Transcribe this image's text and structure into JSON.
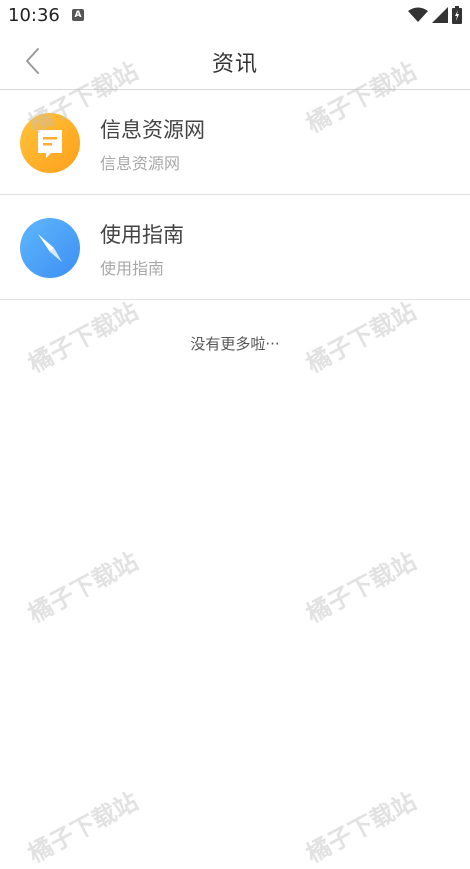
{
  "status_bar": {
    "time": "10:36",
    "notification_icon": "A"
  },
  "header": {
    "title": "资讯"
  },
  "items": [
    {
      "title": "信息资源网",
      "subtitle": "信息资源网",
      "icon": "bookmark-note-icon",
      "icon_color": "#ffae2b"
    },
    {
      "title": "使用指南",
      "subtitle": "使用指南",
      "icon": "compass-icon",
      "icon_color": "#4a9ff6"
    }
  ],
  "footer_text": "没有更多啦···",
  "watermark_text": "橘子下载站"
}
